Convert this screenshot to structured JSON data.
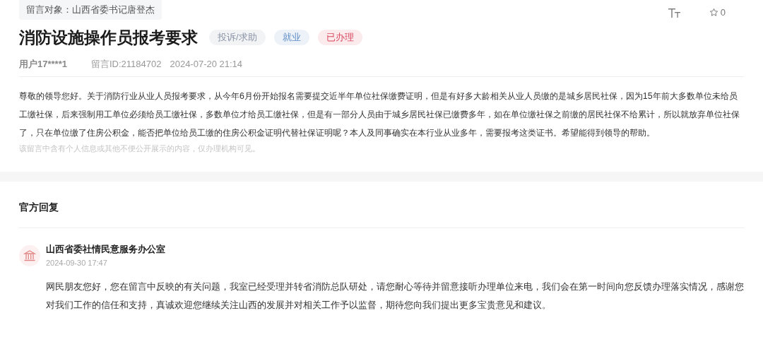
{
  "target": "留言对象：山西省委书记唐登杰",
  "toolbar": {
    "favorites": "0"
  },
  "title": "消防设施操作员报考要求",
  "tags": [
    {
      "label": "投诉/求助",
      "color": "#8a94a6"
    },
    {
      "label": "就业",
      "color": "#5b8bc6"
    },
    {
      "label": "已办理",
      "color": "#d9485f"
    }
  ],
  "meta": {
    "user": "用户17****1",
    "message_id": "留言ID:21184702",
    "time": "2024-07-20 21:14"
  },
  "body": "尊敬的领导您好。关于消防行业从业人员报考要求，从今年6月份开始报名需要提交近半年单位社保缴费证明，但是有好多大龄相关从业人员缴的是城乡居民社保，因为15年前大多数单位未给员工缴社保，后来强制用工单位必须给员工缴社保，多数单位才给员工缴社保，但是有一部分人员由于城乡居民社保已缴费多年，如在单位缴社保之前缴的居民社保不给累计，所以就放弃单位社保了，只在单位缴了住房公积金，能否把单位给员工缴的住房公积金证明代替社保证明呢？本人及同事确实在本行业从业多年，需要报考这类证书。希望能得到领导的帮助。",
  "privacy_note": "该留言中含有个人信息或其他不便公开展示的内容，仅办理机构可见。",
  "reply_section": {
    "heading": "官方回复",
    "replies": [
      {
        "author": "山西省委社情民意服务办公室",
        "time": "2024-09-30 17:47",
        "text": "网民朋友您好，您在留言中反映的有关问题，我室已经受理并转省消防总队研处，请您耐心等待并留意接听办理单位来电，我们会在第一时间向您反馈办理落实情况，感谢您对我们工作的信任和支持，真诚欢迎您继续关注山西的发展并对相关工作予以监督，期待您向我们提出更多宝贵意见和建议。"
      }
    ]
  }
}
